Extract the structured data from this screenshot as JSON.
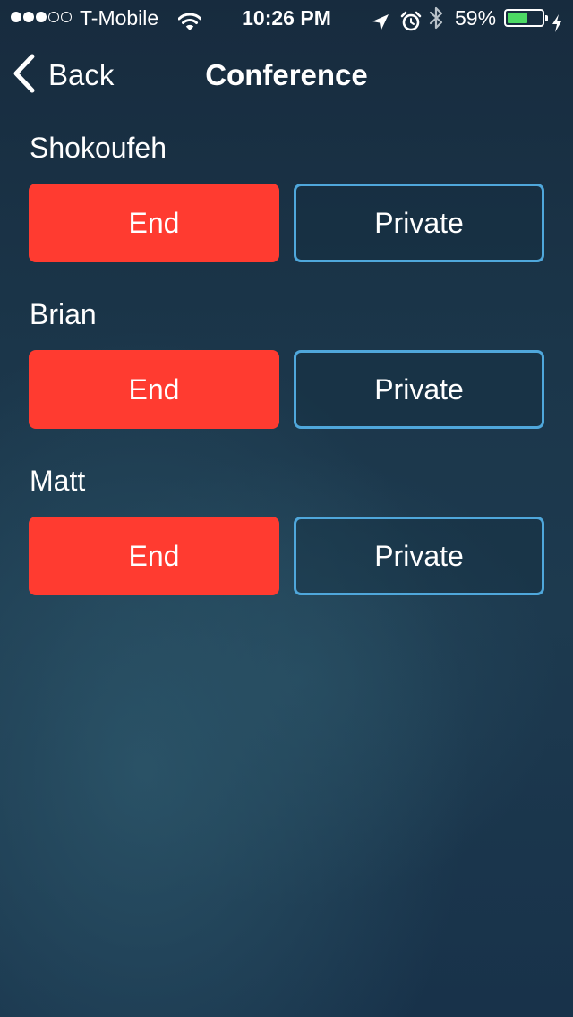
{
  "status_bar": {
    "carrier": "T-Mobile",
    "signal_bars_filled": 3,
    "signal_bars_total": 5,
    "time": "10:26 PM",
    "battery_percent": "59%",
    "battery_level": 0.59,
    "battery_color": "#4cd964",
    "icons": [
      "wifi-icon",
      "location-arrow-icon",
      "alarm-clock-icon",
      "bluetooth-icon",
      "battery-icon",
      "charging-bolt-icon"
    ]
  },
  "nav": {
    "back_label": "Back",
    "title": "Conference"
  },
  "colors": {
    "end_button": "#ff3b30",
    "private_border": "#4fa7db"
  },
  "participants": [
    {
      "name": "Shokoufeh",
      "end_label": "End",
      "private_label": "Private"
    },
    {
      "name": "Brian",
      "end_label": "End",
      "private_label": "Private"
    },
    {
      "name": "Matt",
      "end_label": "End",
      "private_label": "Private"
    }
  ]
}
